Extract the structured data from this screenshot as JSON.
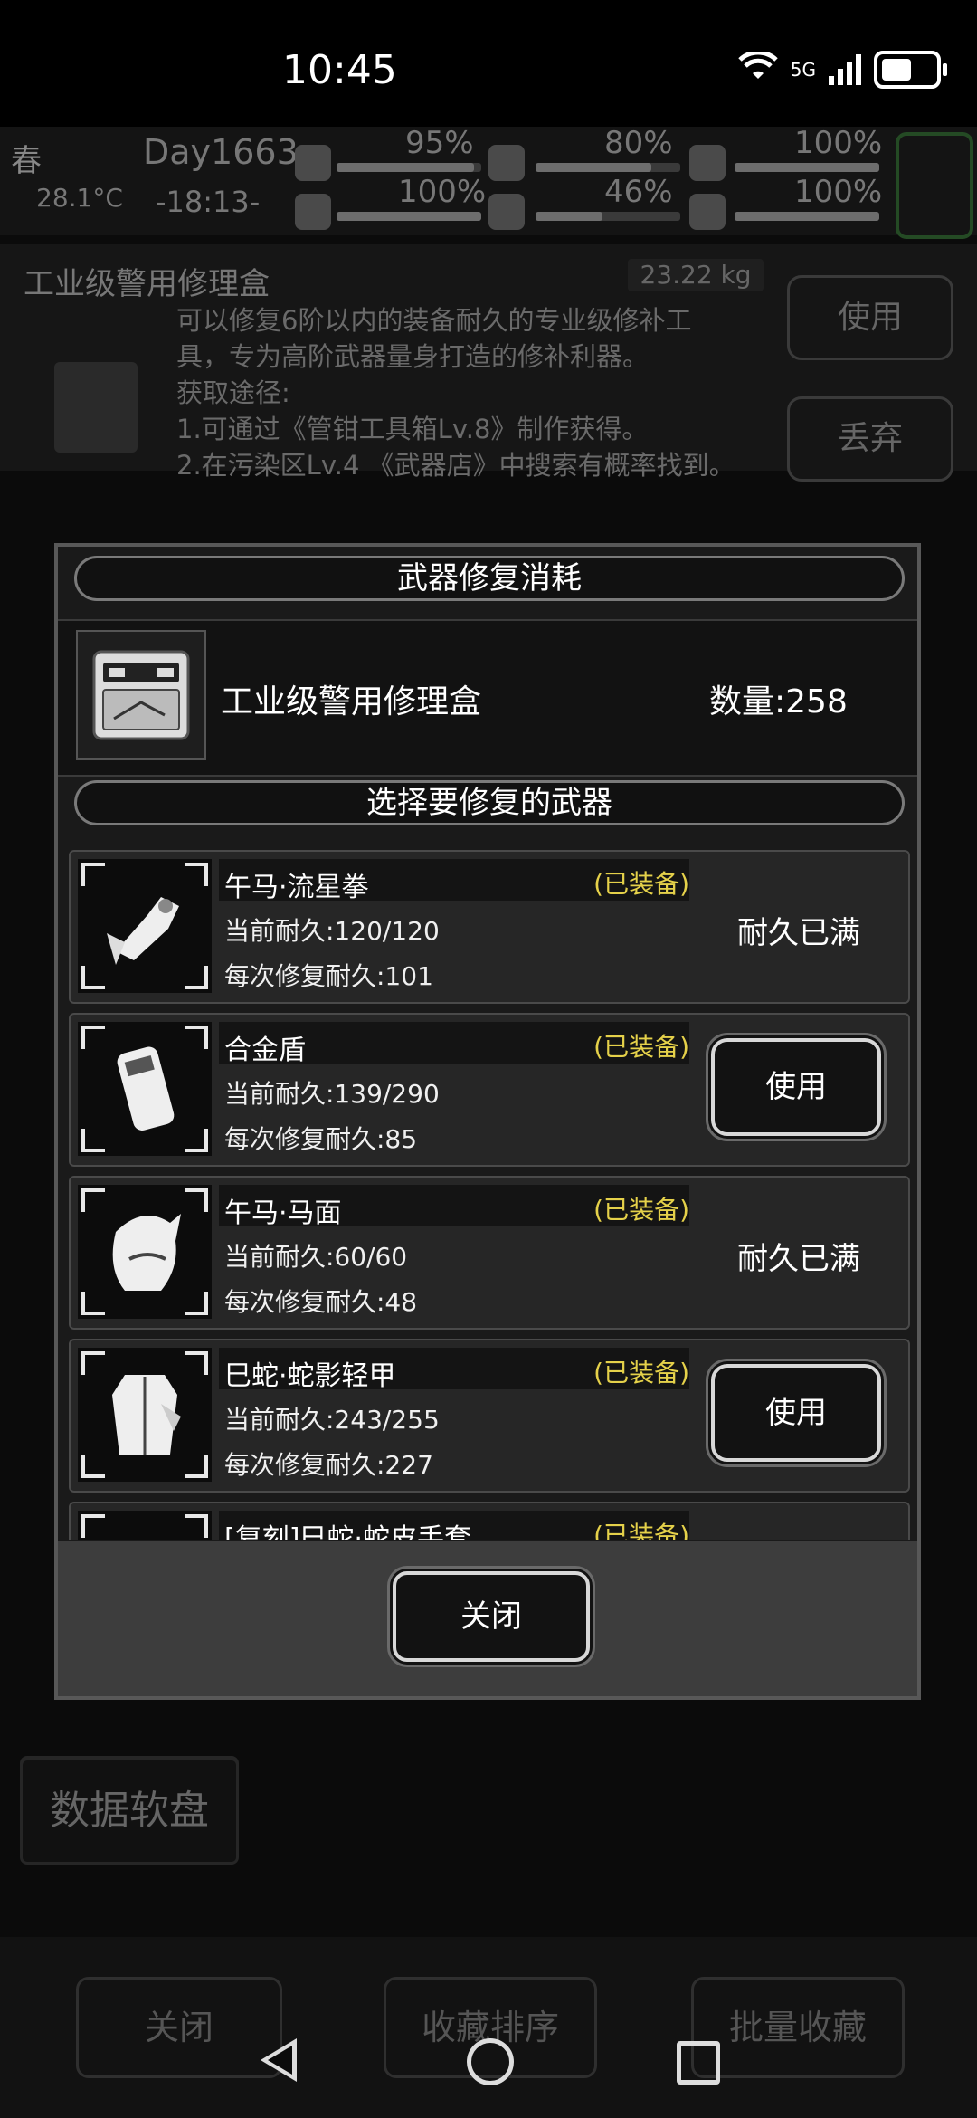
{
  "status_bar": {
    "time": "10:45",
    "network": "5G"
  },
  "hud": {
    "season": "春",
    "temperature": "28.1°C",
    "day": "Day1663",
    "clock": "-18:13-",
    "stats": [
      "95%",
      "80%",
      "100%",
      "100%",
      "46%",
      "100%"
    ]
  },
  "item": {
    "name": "工业级警用修理盒",
    "weight": "23.22 kg",
    "description": [
      "可以修复6阶以内的装备耐久的专业级修补工",
      "具，专为高阶武器量身打造的修补利器。",
      "获取途径:",
      "1.可通过《管钳工具箱Lv.8》制作获得。",
      "2.在污染区Lv.4 《武器店》中搜索有概率找到。"
    ],
    "use_label": "使用",
    "discard_label": "丢弃"
  },
  "sidebar": {
    "visible_label": "数据软盘"
  },
  "bottom_bar": {
    "close": "关闭",
    "sort": "收藏排序",
    "batch": "批量收藏"
  },
  "modal": {
    "title": "武器修复消耗",
    "cost_item_name": "工业级警用修理盒",
    "cost_qty": "数量:258",
    "select_title": "选择要修复的武器",
    "close_label": "关闭",
    "weapons": [
      {
        "name": "午马·流星拳",
        "tag": "(已装备)",
        "current": "当前耐久:120/120",
        "repair": "每次修复耐久:101",
        "action": "耐久已满"
      },
      {
        "name": "合金盾",
        "tag": "(已装备)",
        "current": "当前耐久:139/290",
        "repair": "每次修复耐久:85",
        "action": "使用"
      },
      {
        "name": "午马·马面",
        "tag": "(已装备)",
        "current": "当前耐久:60/60",
        "repair": "每次修复耐久:48",
        "action": "耐久已满"
      },
      {
        "name": "巳蛇·蛇影轻甲",
        "tag": "(已装备)",
        "current": "当前耐久:243/255",
        "repair": "每次修复耐久:227",
        "action": "使用"
      },
      {
        "name": "[复刻]巳蛇·蛇皮手套",
        "tag": "(已装备)",
        "current": "",
        "repair": "",
        "action": ""
      }
    ]
  }
}
